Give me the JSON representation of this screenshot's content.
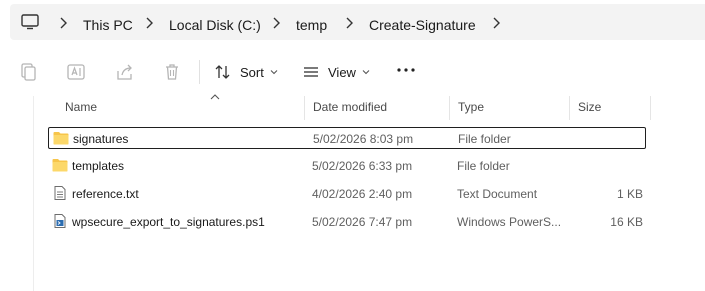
{
  "address": {
    "crumbs": [
      "This PC",
      "Local Disk (C:)",
      "temp",
      "Create-Signature"
    ]
  },
  "toolbar": {
    "sort_label": "Sort",
    "view_label": "View"
  },
  "columns": {
    "name": "Name",
    "date": "Date modified",
    "type": "Type",
    "size": "Size"
  },
  "files": [
    {
      "name": "signatures",
      "date": "5/02/2026 8:03 pm",
      "type": "File folder",
      "size": "",
      "icon": "folder-icon"
    },
    {
      "name": "templates",
      "date": "5/02/2026 6:33 pm",
      "type": "File folder",
      "size": "",
      "icon": "folder-icon"
    },
    {
      "name": "reference.txt",
      "date": "4/02/2026 2:40 pm",
      "type": "Text Document",
      "size": "1 KB",
      "icon": "text-file-icon"
    },
    {
      "name": "wpsecure_export_to_signatures.ps1",
      "date": "5/02/2026 7:47 pm",
      "type": "Windows PowerS...",
      "size": "16 KB",
      "icon": "powershell-file-icon"
    }
  ],
  "colors": {
    "folder": "#f7c54a",
    "accent": "#1f1f1f",
    "muted": "#5f5f5f"
  }
}
